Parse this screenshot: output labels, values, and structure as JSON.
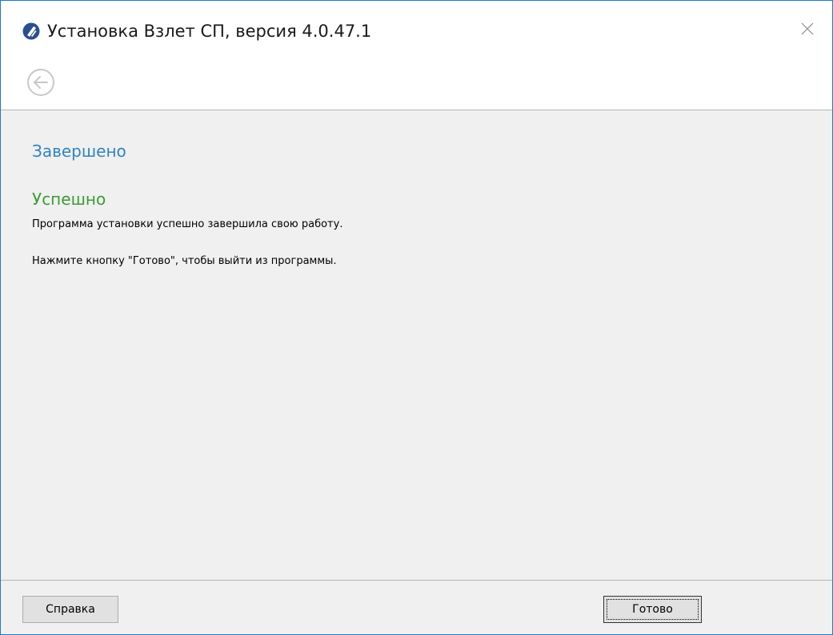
{
  "window": {
    "title": "Установка Взлет СП, версия 4.0.47.1"
  },
  "icons": {
    "app": "app-logo-icon",
    "close": "close-icon",
    "back": "back-arrow-icon"
  },
  "colors": {
    "section_title": "#2f84c4",
    "success_title": "#3d9b35",
    "window_border": "#1e78c8"
  },
  "content": {
    "section_title": "Завершено",
    "status_title": "Успешно",
    "message_line1": "Программа установки успешно завершила свою работу.",
    "message_line2": "Нажмите кнопку \"Готово\", чтобы выйти из программы."
  },
  "footer": {
    "help_label": "Справка",
    "finish_label": "Готово"
  }
}
